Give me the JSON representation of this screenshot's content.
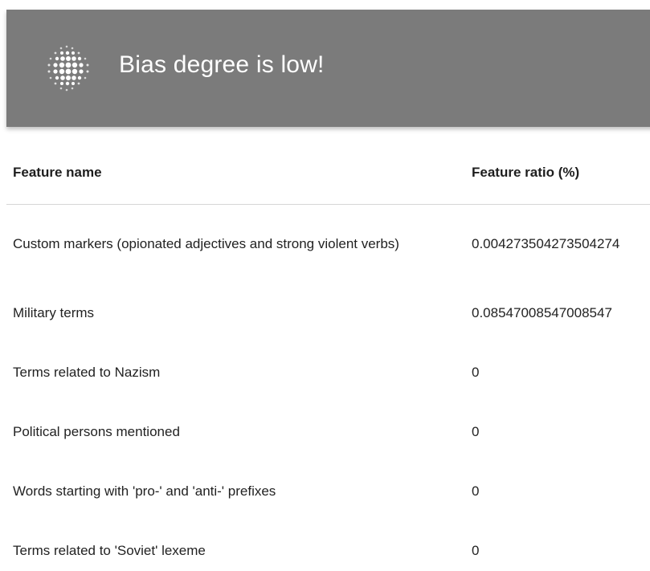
{
  "banner": {
    "title": "Bias degree is low!",
    "icon": "dotted-sphere-icon",
    "background_color": "#7b7b7b"
  },
  "table": {
    "columns": [
      "Feature name",
      "Feature ratio (%)"
    ],
    "rows": [
      {
        "name": "Custom markers (opionated adjectives and strong violent verbs)",
        "ratio": "0.004273504273504274"
      },
      {
        "name": "Military terms",
        "ratio": "0.08547008547008547"
      },
      {
        "name": "Terms related to Nazism",
        "ratio": "0"
      },
      {
        "name": "Political persons mentioned",
        "ratio": "0"
      },
      {
        "name": "Words starting with 'pro-' and 'anti-' prefixes",
        "ratio": "0"
      },
      {
        "name": "Terms related to 'Soviet' lexeme",
        "ratio": "0"
      }
    ]
  }
}
